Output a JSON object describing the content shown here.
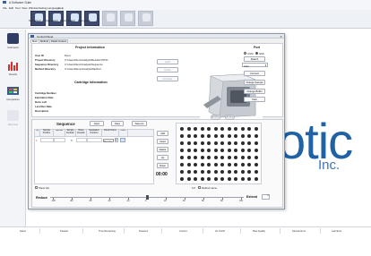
{
  "app_title": "A Software Suite",
  "menu": [
    "File",
    "Edit",
    "Tool",
    "View",
    "Window",
    "Setting",
    "Language",
    "Help"
  ],
  "toolbar": [
    {
      "label": "New project",
      "icon": "new-project-icon",
      "enabled": true
    },
    {
      "label": "Open project",
      "icon": "open-project-icon",
      "enabled": true
    },
    {
      "label": "Recent project",
      "icon": "recent-project-icon",
      "enabled": true
    },
    {
      "label": "Save project",
      "icon": "save-project-icon",
      "enabled": true
    },
    {
      "label": "",
      "icon": "disabled-tool-icon",
      "enabled": false
    },
    {
      "label": "",
      "icon": "disabled-tool-icon",
      "enabled": false
    },
    {
      "label": "",
      "icon": "disabled-tool-icon",
      "enabled": false
    }
  ],
  "nav": [
    {
      "label": "Instrument",
      "icon": "instrument-icon"
    },
    {
      "label": "Results",
      "icon": "results-icon"
    },
    {
      "label": "Comparison",
      "icon": "comparison-icon"
    },
    {
      "label": "Real time",
      "icon": "realtime-icon"
    }
  ],
  "logo": {
    "main": "otic",
    "sub": "Inc.",
    "color": "#1f63a6"
  },
  "dialog": {
    "title": "Control Panel",
    "tabs": [
      "Main",
      "Method",
      "Detail Content"
    ],
    "project": {
      "title": "Project Information",
      "fields": [
        {
          "label": "User ID",
          "value": "Demo"
        },
        {
          "label": "Project Directory",
          "value": "C:\\Users\\Nunc\\Analysis\\Results\\TST21"
        },
        {
          "label": "Sequence Directory",
          "value": "C:\\Users\\Nunc\\Analysis\\Sequence"
        },
        {
          "label": "Method Directory",
          "value": "C:\\Users\\Demo\\Analysis\\Method"
        }
      ],
      "buttons": [
        "Latch",
        "Home",
        "Continue"
      ]
    },
    "cartridge": {
      "title": "Cartridge Information",
      "fields": [
        "Cartridge Number",
        "Expiration Date",
        "Runs Left",
        "Last Run Date",
        "Description"
      ]
    },
    "port": {
      "title": "Port",
      "options": [
        "COM",
        "NAS"
      ],
      "search": "Search",
      "select": "Auto",
      "buttons": [
        "Connect",
        "Change Sample",
        "Change Buffer",
        "Park"
      ]
    },
    "instrument_buttons": [
      "Run",
      "Stop"
    ],
    "sequence": {
      "title": "Sequence",
      "buttons": [
        "Open",
        "Save",
        "Save As"
      ],
      "columns": [
        "Inj",
        "Sample Position",
        "Method",
        "Sample Duration",
        "Rinse Duration",
        "Separation Duration",
        "Result Name",
        "Para."
      ],
      "row": {
        "inj": "1",
        "sample": "",
        "rinse": "",
        "sample_dur": "0",
        "result": "Result"
      },
      "side_buttons": [
        "Add",
        "Insert",
        "Delete",
        "Up",
        "Down"
      ],
      "timer": "00:00"
    },
    "show_val": "Show Val",
    "method_name": "Method name",
    "method_val": "0.0",
    "reduce": "Reduce",
    "extend": "Extend",
    "slider": {
      "min": -100,
      "max": 100,
      "ticks": [
        "-100",
        "-80",
        "-60",
        "-40",
        "-20",
        "0",
        "20",
        "40",
        "60",
        "80",
        "100"
      ],
      "value": 0
    }
  },
  "status": [
    "status",
    "Position",
    "Time Remaining",
    "Pressure",
    "Current",
    "Hv On/Off",
    "Raw Quality",
    "Sample Error",
    "Last Error"
  ]
}
